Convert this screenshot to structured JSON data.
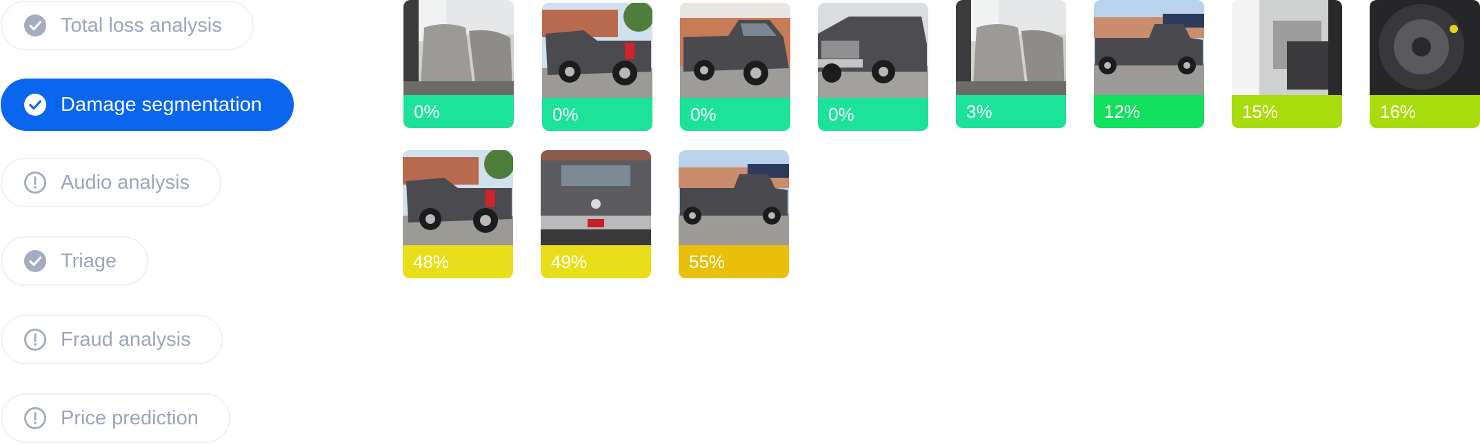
{
  "sidebar": {
    "items": [
      {
        "label": "Total loss analysis",
        "status": "check",
        "active": false
      },
      {
        "label": "Damage segmentation",
        "status": "check",
        "active": true
      },
      {
        "label": "Audio analysis",
        "status": "alert",
        "active": false
      },
      {
        "label": "Triage",
        "status": "check",
        "active": false
      },
      {
        "label": "Fraud analysis",
        "status": "alert",
        "active": false
      },
      {
        "label": "Price prediction",
        "status": "alert",
        "active": false
      }
    ]
  },
  "gallery": {
    "images": [
      {
        "score": "0%",
        "view": "rear-seat interior",
        "color": "#1de29a"
      },
      {
        "score": "0%",
        "view": "rear-quarter damaged",
        "color": "#1de29a"
      },
      {
        "score": "0%",
        "view": "front three-quarter",
        "color": "#1de29a"
      },
      {
        "score": "0%",
        "view": "front",
        "color": "#1de29a"
      },
      {
        "score": "3%",
        "view": "rear-seat interior",
        "color": "#1de29a"
      },
      {
        "score": "12%",
        "view": "side profile",
        "color": "#12e05e"
      },
      {
        "score": "15%",
        "view": "driver door interior",
        "color": "#a9dc0c"
      },
      {
        "score": "16%",
        "view": "wheel close-up",
        "color": "#a9dc0c"
      },
      {
        "score": "48%",
        "view": "rear-quarter damaged",
        "color": "#e8df1a"
      },
      {
        "score": "49%",
        "view": "rear tailgate",
        "color": "#e8df1a"
      },
      {
        "score": "55%",
        "view": "side profile",
        "color": "#e8bf0a"
      }
    ]
  }
}
